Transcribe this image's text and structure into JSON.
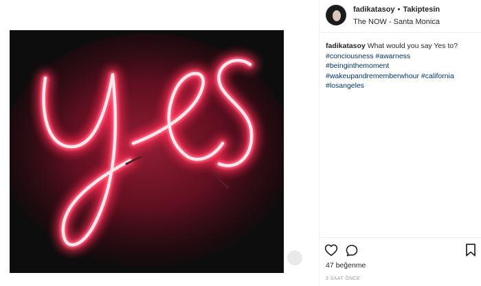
{
  "post": {
    "username": "fadikatasoy",
    "separator": "•",
    "follow_status": "Takiptesin",
    "location": "The NOW - Santa Monica",
    "photo_text": "yes",
    "caption": {
      "username": "fadikatasoy",
      "text": "What would you say Yes to?",
      "hashtags": [
        "#conciousness",
        "#awarness",
        "#beinginthemoment",
        "#wakeupandrememberwhour",
        "#california",
        "#losangeles"
      ]
    },
    "likes_text": "47 beğenme",
    "time_text": "3 SAAT ÖNCE"
  },
  "icons": {
    "like": "heart-icon",
    "comment": "comment-bubble-icon",
    "save": "bookmark-icon"
  },
  "colors": {
    "neon": "#ff2a55",
    "neon_core": "#ffe6ec",
    "hashtag": "#003569",
    "border": "#efefef"
  }
}
